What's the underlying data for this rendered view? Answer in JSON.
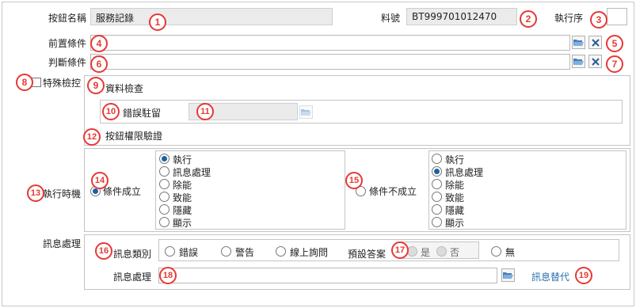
{
  "header": {
    "button_name_label": "按鈕名稱",
    "button_name_value": "服務記錄",
    "part_no_label": "料號",
    "part_no_value": "BT999701012470",
    "exec_order_label": "執行序"
  },
  "prerequisite_label": "前置條件",
  "judgement_label": "判斷條件",
  "special_check": {
    "label": "特殊檢控",
    "data_check_label": "資料檢查",
    "error_stay_label": "錯誤駐留",
    "button_permission_label": "按鈕權限驗證"
  },
  "exec_timing": {
    "label": "執行時機",
    "condition_true_label": "條件成立",
    "condition_false_label": "條件不成立",
    "actions": [
      "執行",
      "訊息處理",
      "除能",
      "致能",
      "隱藏",
      "顯示"
    ],
    "true_selected_index": 0,
    "false_selected_index": 1
  },
  "message": {
    "section_label": "訊息處理",
    "type_label": "訊息類別",
    "types": [
      "錯誤",
      "警告",
      "線上詢問"
    ],
    "default_answer_label": "預設答案",
    "default_answers": [
      "是",
      "否"
    ],
    "none_label": "無",
    "handling_label": "訊息處理",
    "replace_link": "訊息替代"
  },
  "badges": [
    "1",
    "2",
    "3",
    "4",
    "5",
    "6",
    "7",
    "8",
    "9",
    "10",
    "11",
    "12",
    "13",
    "14",
    "15",
    "16",
    "17",
    "18",
    "19"
  ],
  "colors": {
    "badge": "#e53935",
    "link": "#2a6fb0",
    "radio_selected": "#1f5fa8"
  }
}
